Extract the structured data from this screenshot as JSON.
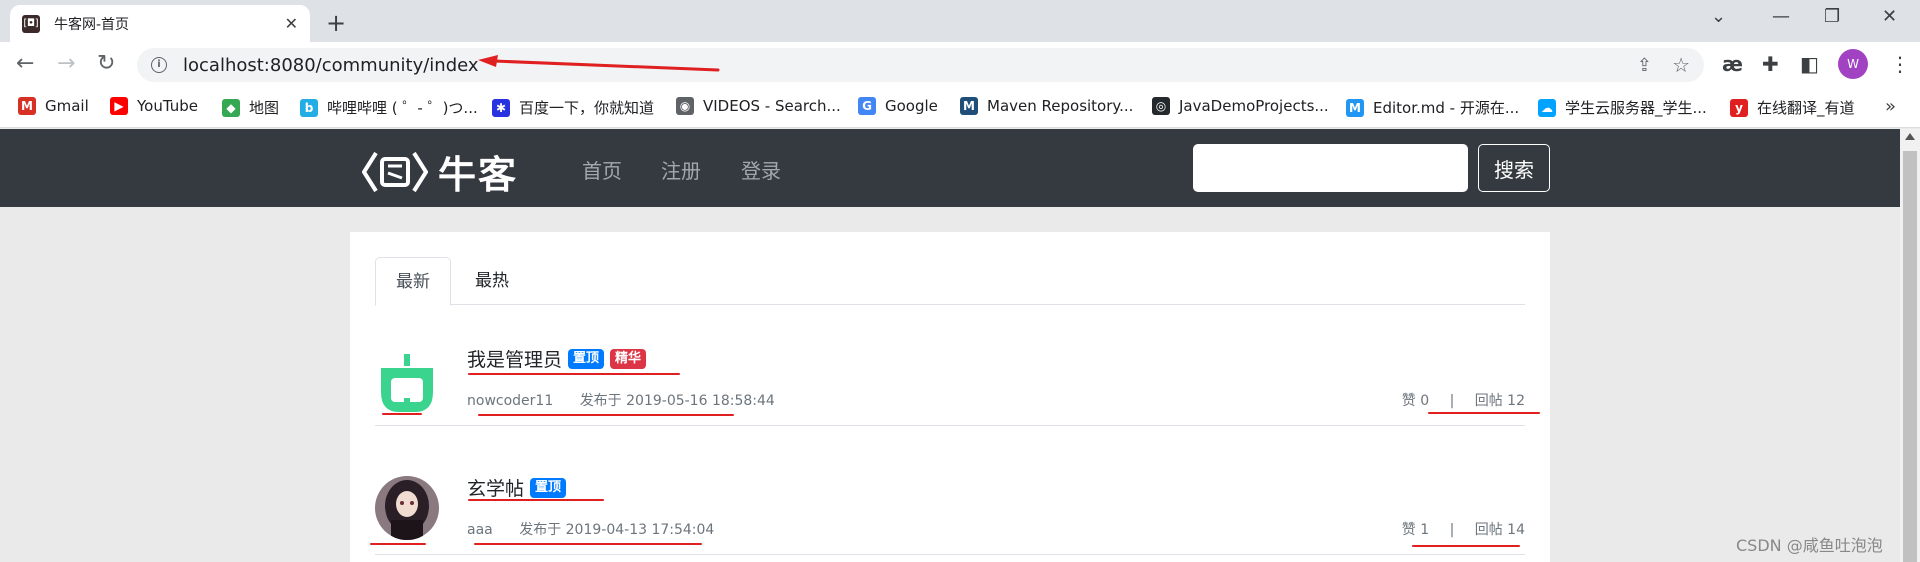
{
  "browser": {
    "tab_title": "牛客网-首页",
    "url": "localhost:8080/community/index",
    "profile_initial": "W",
    "bookmarks": [
      {
        "label": "Gmail",
        "icon": "gmail-icon",
        "color": "#d93025",
        "glyph": "M"
      },
      {
        "label": "YouTube",
        "icon": "youtube-icon",
        "color": "#ff0000",
        "glyph": "▶"
      },
      {
        "label": "地图",
        "icon": "maps-icon",
        "color": "#34a853",
        "glyph": "◆"
      },
      {
        "label": "哔哩哔哩 ( ゜- ゜)つ...",
        "icon": "bilibili-icon",
        "color": "#23ade5",
        "glyph": "b"
      },
      {
        "label": "百度一下，你就知道",
        "icon": "baidu-icon",
        "color": "#2932e1",
        "glyph": "✱"
      },
      {
        "label": "VIDEOS - Search...",
        "icon": "globe-icon",
        "color": "#5f6368",
        "glyph": "◉"
      },
      {
        "label": "Google",
        "icon": "google-icon",
        "color": "#4285f4",
        "glyph": "G"
      },
      {
        "label": "Maven Repository...",
        "icon": "maven-icon",
        "color": "#1f4e79",
        "glyph": "M"
      },
      {
        "label": "JavaDemoProjects...",
        "icon": "github-icon",
        "color": "#24292e",
        "glyph": "◎"
      },
      {
        "label": "Editor.md - 开源在...",
        "icon": "editormd-icon",
        "color": "#2196f3",
        "glyph": "M"
      },
      {
        "label": "学生云服务器_学生...",
        "icon": "cloud-icon",
        "color": "#00a3ff",
        "glyph": "☁"
      },
      {
        "label": "在线翻译_有道",
        "icon": "youdao-icon",
        "color": "#e02020",
        "glyph": "y"
      }
    ]
  },
  "site": {
    "logo_text": "牛客",
    "nav": [
      "首页",
      "注册",
      "登录"
    ],
    "search_button": "搜索",
    "search_value": ""
  },
  "tabs": [
    "最新",
    "最热"
  ],
  "posts": [
    {
      "title": "我是管理员",
      "badges": [
        "置顶",
        "精华"
      ],
      "author": "nowcoder11",
      "published": "发布于 2019-05-16 18:58:44",
      "likes": "赞 0",
      "separator": "|",
      "replies": "回帖 12"
    },
    {
      "title": "玄学帖",
      "badges": [
        "置顶"
      ],
      "author": "aaa",
      "published": "发布于 2019-04-13 17:54:04",
      "likes": "赞 1",
      "separator": "|",
      "replies": "回帖 14"
    }
  ],
  "watermark": "CSDN @咸鱼吐泡泡",
  "colors": {
    "header_bg": "#343a40",
    "badge_top": "#007bff",
    "badge_wonderful": "#dc3545",
    "annotation": "#e02020"
  }
}
